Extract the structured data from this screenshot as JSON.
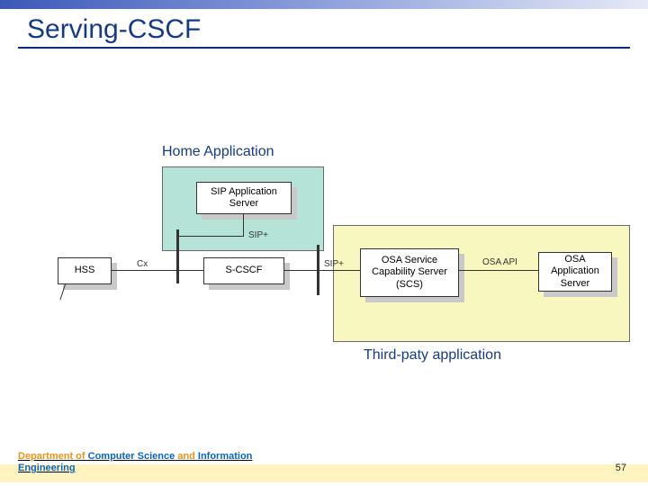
{
  "title": "Serving-CSCF",
  "labels": {
    "home": "Home Application",
    "third": "Third-paty application"
  },
  "boxes": {
    "sip_as": "SIP Application Server",
    "hss": "HSS",
    "scscf": "S-CSCF",
    "scs": "OSA Service Capability Server (SCS)",
    "osa_as": "OSA Application Server"
  },
  "conn": {
    "cx": "Cx",
    "sip_plus_v": "SIP+",
    "sip_plus_h": "SIP+",
    "osa_api": "OSA API"
  },
  "footer": {
    "line1_a": "Department of ",
    "line1_b": "Computer Science ",
    "line1_c": "and ",
    "line1_d": "Information",
    "line2": "Engineering"
  },
  "page": "57"
}
